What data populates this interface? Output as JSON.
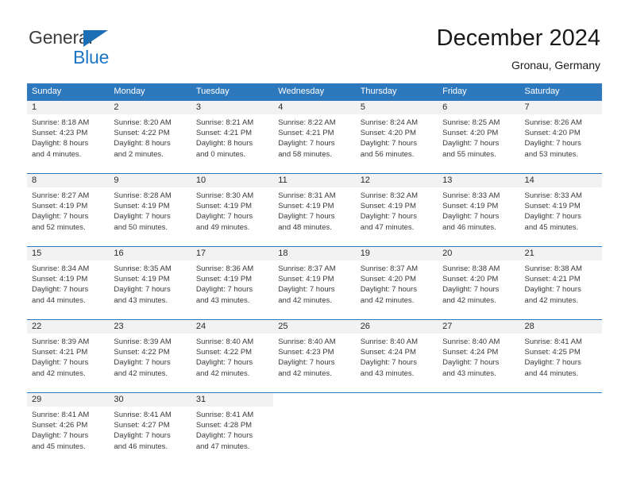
{
  "brand": {
    "name_part1": "General",
    "name_part2": "Blue",
    "triangle_icon": "triangle-icon",
    "color_dark": "#3d3d3d",
    "color_blue": "#1c76c4"
  },
  "header": {
    "title": "December 2024",
    "subtitle": "Gronau, Germany"
  },
  "calendar": {
    "accent_color": "#2e78bd",
    "day_band_color": "#f2f2f2",
    "weekdays": [
      "Sunday",
      "Monday",
      "Tuesday",
      "Wednesday",
      "Thursday",
      "Friday",
      "Saturday"
    ],
    "weeks": [
      [
        {
          "day": "1",
          "sunrise": "Sunrise: 8:18 AM",
          "sunset": "Sunset: 4:23 PM",
          "daylight_line1": "Daylight: 8 hours",
          "daylight_line2": "and 4 minutes."
        },
        {
          "day": "2",
          "sunrise": "Sunrise: 8:20 AM",
          "sunset": "Sunset: 4:22 PM",
          "daylight_line1": "Daylight: 8 hours",
          "daylight_line2": "and 2 minutes."
        },
        {
          "day": "3",
          "sunrise": "Sunrise: 8:21 AM",
          "sunset": "Sunset: 4:21 PM",
          "daylight_line1": "Daylight: 8 hours",
          "daylight_line2": "and 0 minutes."
        },
        {
          "day": "4",
          "sunrise": "Sunrise: 8:22 AM",
          "sunset": "Sunset: 4:21 PM",
          "daylight_line1": "Daylight: 7 hours",
          "daylight_line2": "and 58 minutes."
        },
        {
          "day": "5",
          "sunrise": "Sunrise: 8:24 AM",
          "sunset": "Sunset: 4:20 PM",
          "daylight_line1": "Daylight: 7 hours",
          "daylight_line2": "and 56 minutes."
        },
        {
          "day": "6",
          "sunrise": "Sunrise: 8:25 AM",
          "sunset": "Sunset: 4:20 PM",
          "daylight_line1": "Daylight: 7 hours",
          "daylight_line2": "and 55 minutes."
        },
        {
          "day": "7",
          "sunrise": "Sunrise: 8:26 AM",
          "sunset": "Sunset: 4:20 PM",
          "daylight_line1": "Daylight: 7 hours",
          "daylight_line2": "and 53 minutes."
        }
      ],
      [
        {
          "day": "8",
          "sunrise": "Sunrise: 8:27 AM",
          "sunset": "Sunset: 4:19 PM",
          "daylight_line1": "Daylight: 7 hours",
          "daylight_line2": "and 52 minutes."
        },
        {
          "day": "9",
          "sunrise": "Sunrise: 8:28 AM",
          "sunset": "Sunset: 4:19 PM",
          "daylight_line1": "Daylight: 7 hours",
          "daylight_line2": "and 50 minutes."
        },
        {
          "day": "10",
          "sunrise": "Sunrise: 8:30 AM",
          "sunset": "Sunset: 4:19 PM",
          "daylight_line1": "Daylight: 7 hours",
          "daylight_line2": "and 49 minutes."
        },
        {
          "day": "11",
          "sunrise": "Sunrise: 8:31 AM",
          "sunset": "Sunset: 4:19 PM",
          "daylight_line1": "Daylight: 7 hours",
          "daylight_line2": "and 48 minutes."
        },
        {
          "day": "12",
          "sunrise": "Sunrise: 8:32 AM",
          "sunset": "Sunset: 4:19 PM",
          "daylight_line1": "Daylight: 7 hours",
          "daylight_line2": "and 47 minutes."
        },
        {
          "day": "13",
          "sunrise": "Sunrise: 8:33 AM",
          "sunset": "Sunset: 4:19 PM",
          "daylight_line1": "Daylight: 7 hours",
          "daylight_line2": "and 46 minutes."
        },
        {
          "day": "14",
          "sunrise": "Sunrise: 8:33 AM",
          "sunset": "Sunset: 4:19 PM",
          "daylight_line1": "Daylight: 7 hours",
          "daylight_line2": "and 45 minutes."
        }
      ],
      [
        {
          "day": "15",
          "sunrise": "Sunrise: 8:34 AM",
          "sunset": "Sunset: 4:19 PM",
          "daylight_line1": "Daylight: 7 hours",
          "daylight_line2": "and 44 minutes."
        },
        {
          "day": "16",
          "sunrise": "Sunrise: 8:35 AM",
          "sunset": "Sunset: 4:19 PM",
          "daylight_line1": "Daylight: 7 hours",
          "daylight_line2": "and 43 minutes."
        },
        {
          "day": "17",
          "sunrise": "Sunrise: 8:36 AM",
          "sunset": "Sunset: 4:19 PM",
          "daylight_line1": "Daylight: 7 hours",
          "daylight_line2": "and 43 minutes."
        },
        {
          "day": "18",
          "sunrise": "Sunrise: 8:37 AM",
          "sunset": "Sunset: 4:19 PM",
          "daylight_line1": "Daylight: 7 hours",
          "daylight_line2": "and 42 minutes."
        },
        {
          "day": "19",
          "sunrise": "Sunrise: 8:37 AM",
          "sunset": "Sunset: 4:20 PM",
          "daylight_line1": "Daylight: 7 hours",
          "daylight_line2": "and 42 minutes."
        },
        {
          "day": "20",
          "sunrise": "Sunrise: 8:38 AM",
          "sunset": "Sunset: 4:20 PM",
          "daylight_line1": "Daylight: 7 hours",
          "daylight_line2": "and 42 minutes."
        },
        {
          "day": "21",
          "sunrise": "Sunrise: 8:38 AM",
          "sunset": "Sunset: 4:21 PM",
          "daylight_line1": "Daylight: 7 hours",
          "daylight_line2": "and 42 minutes."
        }
      ],
      [
        {
          "day": "22",
          "sunrise": "Sunrise: 8:39 AM",
          "sunset": "Sunset: 4:21 PM",
          "daylight_line1": "Daylight: 7 hours",
          "daylight_line2": "and 42 minutes."
        },
        {
          "day": "23",
          "sunrise": "Sunrise: 8:39 AM",
          "sunset": "Sunset: 4:22 PM",
          "daylight_line1": "Daylight: 7 hours",
          "daylight_line2": "and 42 minutes."
        },
        {
          "day": "24",
          "sunrise": "Sunrise: 8:40 AM",
          "sunset": "Sunset: 4:22 PM",
          "daylight_line1": "Daylight: 7 hours",
          "daylight_line2": "and 42 minutes."
        },
        {
          "day": "25",
          "sunrise": "Sunrise: 8:40 AM",
          "sunset": "Sunset: 4:23 PM",
          "daylight_line1": "Daylight: 7 hours",
          "daylight_line2": "and 42 minutes."
        },
        {
          "day": "26",
          "sunrise": "Sunrise: 8:40 AM",
          "sunset": "Sunset: 4:24 PM",
          "daylight_line1": "Daylight: 7 hours",
          "daylight_line2": "and 43 minutes."
        },
        {
          "day": "27",
          "sunrise": "Sunrise: 8:40 AM",
          "sunset": "Sunset: 4:24 PM",
          "daylight_line1": "Daylight: 7 hours",
          "daylight_line2": "and 43 minutes."
        },
        {
          "day": "28",
          "sunrise": "Sunrise: 8:41 AM",
          "sunset": "Sunset: 4:25 PM",
          "daylight_line1": "Daylight: 7 hours",
          "daylight_line2": "and 44 minutes."
        }
      ],
      [
        {
          "day": "29",
          "sunrise": "Sunrise: 8:41 AM",
          "sunset": "Sunset: 4:26 PM",
          "daylight_line1": "Daylight: 7 hours",
          "daylight_line2": "and 45 minutes."
        },
        {
          "day": "30",
          "sunrise": "Sunrise: 8:41 AM",
          "sunset": "Sunset: 4:27 PM",
          "daylight_line1": "Daylight: 7 hours",
          "daylight_line2": "and 46 minutes."
        },
        {
          "day": "31",
          "sunrise": "Sunrise: 8:41 AM",
          "sunset": "Sunset: 4:28 PM",
          "daylight_line1": "Daylight: 7 hours",
          "daylight_line2": "and 47 minutes."
        },
        {
          "day": "",
          "sunrise": "",
          "sunset": "",
          "daylight_line1": "",
          "daylight_line2": ""
        },
        {
          "day": "",
          "sunrise": "",
          "sunset": "",
          "daylight_line1": "",
          "daylight_line2": ""
        },
        {
          "day": "",
          "sunrise": "",
          "sunset": "",
          "daylight_line1": "",
          "daylight_line2": ""
        },
        {
          "day": "",
          "sunrise": "",
          "sunset": "",
          "daylight_line1": "",
          "daylight_line2": ""
        }
      ]
    ]
  }
}
